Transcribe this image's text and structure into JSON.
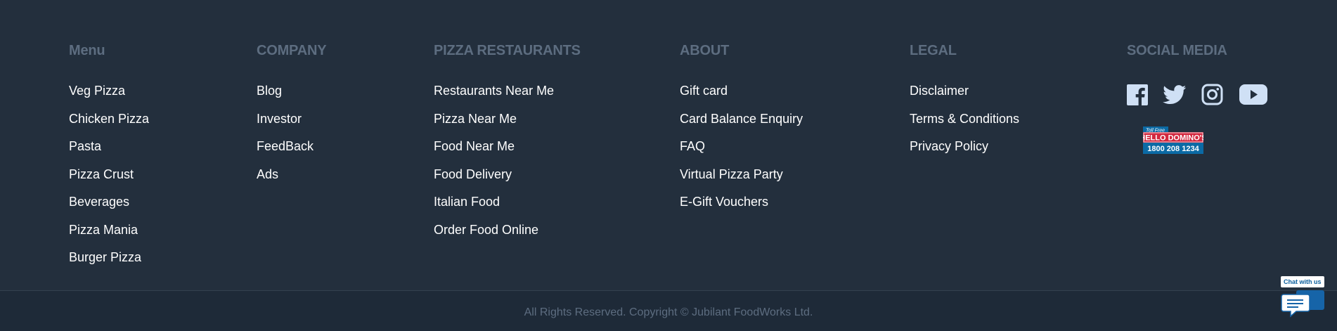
{
  "columns": [
    {
      "heading": "Menu",
      "links": [
        "Veg Pizza",
        "Chicken Pizza",
        "Pasta",
        "Pizza Crust",
        "Beverages",
        "Pizza Mania",
        "Burger Pizza"
      ]
    },
    {
      "heading": "COMPANY",
      "links": [
        "Blog",
        "Investor",
        "FeedBack",
        "Ads"
      ]
    },
    {
      "heading": "PIZZA RESTAURANTS",
      "links": [
        "Restaurants Near Me",
        "Pizza Near Me",
        "Food Near Me",
        "Food Delivery",
        "Italian Food",
        "Order Food Online"
      ]
    },
    {
      "heading": "ABOUT",
      "links": [
        "Gift card",
        "Card Balance Enquiry",
        "FAQ",
        "Virtual Pizza Party",
        "E-Gift Vouchers"
      ]
    },
    {
      "heading": "LEGAL",
      "links": [
        "Disclaimer",
        "Terms & Conditions",
        "Privacy Policy"
      ]
    }
  ],
  "social": {
    "heading": "SOCIAL MEDIA",
    "icons": [
      "facebook-icon",
      "twitter-icon",
      "instagram-icon",
      "youtube-icon"
    ],
    "tollfree": {
      "tag": "Toll Free",
      "title": "HELLO DOMINO'S",
      "number": "1800 208 1234"
    }
  },
  "copyright": "All Rights Reserved. Copyright © Jubilant FoodWorks Ltd.",
  "chat": {
    "label": "Chat with us"
  },
  "colors": {
    "background": "#232f3d",
    "heading": "#5d6d80",
    "link": "#ffffff",
    "icon": "#cfe0f5",
    "brand_red": "#d3283f",
    "brand_blue": "#0b6aa5"
  }
}
